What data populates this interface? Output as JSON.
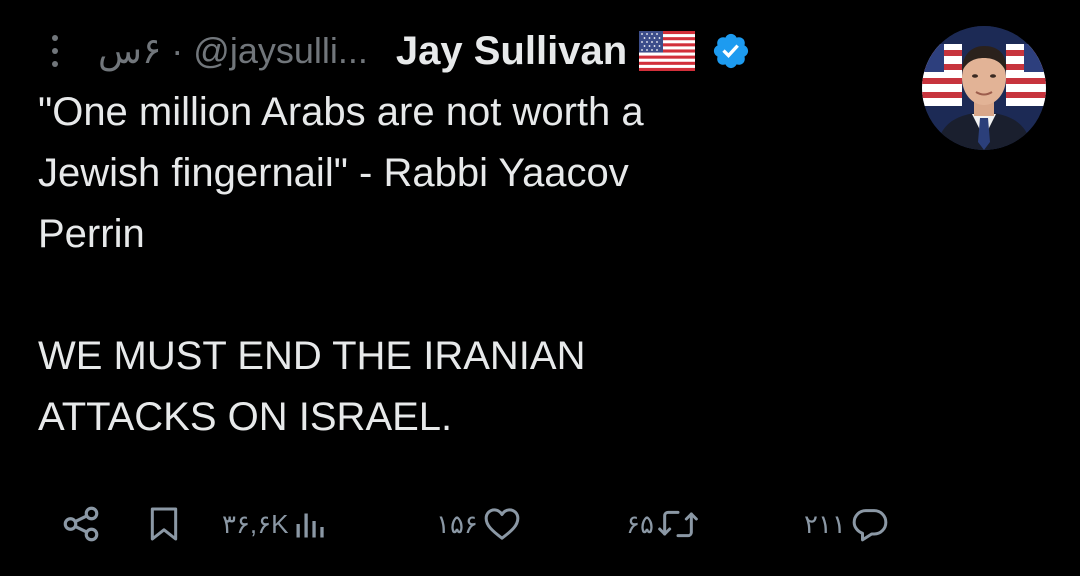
{
  "header": {
    "more_icon": "more-vertical-icon",
    "time": "۶س",
    "separator": "·",
    "handle": "@jaysulli...",
    "display_name": "Jay Sullivan",
    "flag_icon": "us-flag-icon",
    "verified_icon": "verified-badge-icon",
    "verified_color": "#1d9bf0"
  },
  "tweet": {
    "paragraph_1": "\"One million Arabs are not worth a\nJewish fingernail\" - Rabbi Yaacov\nPerrin",
    "paragraph_2": "WE MUST END THE IRANIAN\nATTACKS ON ISRAEL."
  },
  "actions": {
    "share_icon": "share-icon",
    "bookmark_icon": "bookmark-icon",
    "views_icon": "views-chart-icon",
    "views_count": "۳۶,۶K",
    "likes_icon": "heart-icon",
    "likes_count": "۱۵۶",
    "reposts_icon": "repost-icon",
    "reposts_count": "۶۵",
    "replies_icon": "reply-icon",
    "replies_count": "۲۱۱"
  },
  "colors": {
    "background": "#000000",
    "text_primary": "#e7e9ea",
    "text_secondary": "#71767b",
    "icon_color": "#8b98a5"
  }
}
